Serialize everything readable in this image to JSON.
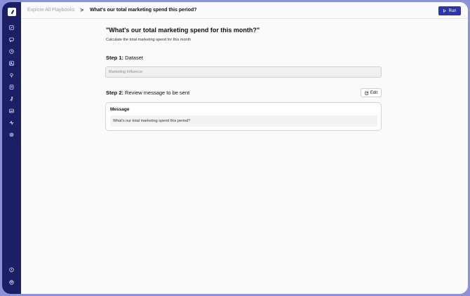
{
  "breadcrumb": {
    "parent": "Explore All Playbooks",
    "separator": ">",
    "current": "What's our total marketing spend this period?"
  },
  "toolbar": {
    "run_label": "Run"
  },
  "sidebar": {
    "icons": [
      "edit-icon",
      "chat-icon",
      "history-icon",
      "image-icon",
      "pin-icon",
      "book-icon",
      "run-person-icon",
      "photo-icon",
      "activity-icon",
      "settings-icon"
    ],
    "bottom_icons": [
      "help-icon",
      "account-icon"
    ]
  },
  "playbook": {
    "title": "\"What's our total marketing spend for this month?\"",
    "subtitle": "Calculate the total marketing spend for this month"
  },
  "step1": {
    "prefix": "Step 1:",
    "label": " Dataset",
    "dataset_value": "Marketing Influence"
  },
  "step2": {
    "prefix": "Step 2:",
    "label": " Review message to be sent",
    "edit_label": "Edit",
    "message_heading": "Message",
    "message_text": "What's our total marketing spend this period?"
  },
  "colors": {
    "sidebar": "#1a1f66",
    "accent": "#2d35a8",
    "frame": "#8d92d8"
  }
}
